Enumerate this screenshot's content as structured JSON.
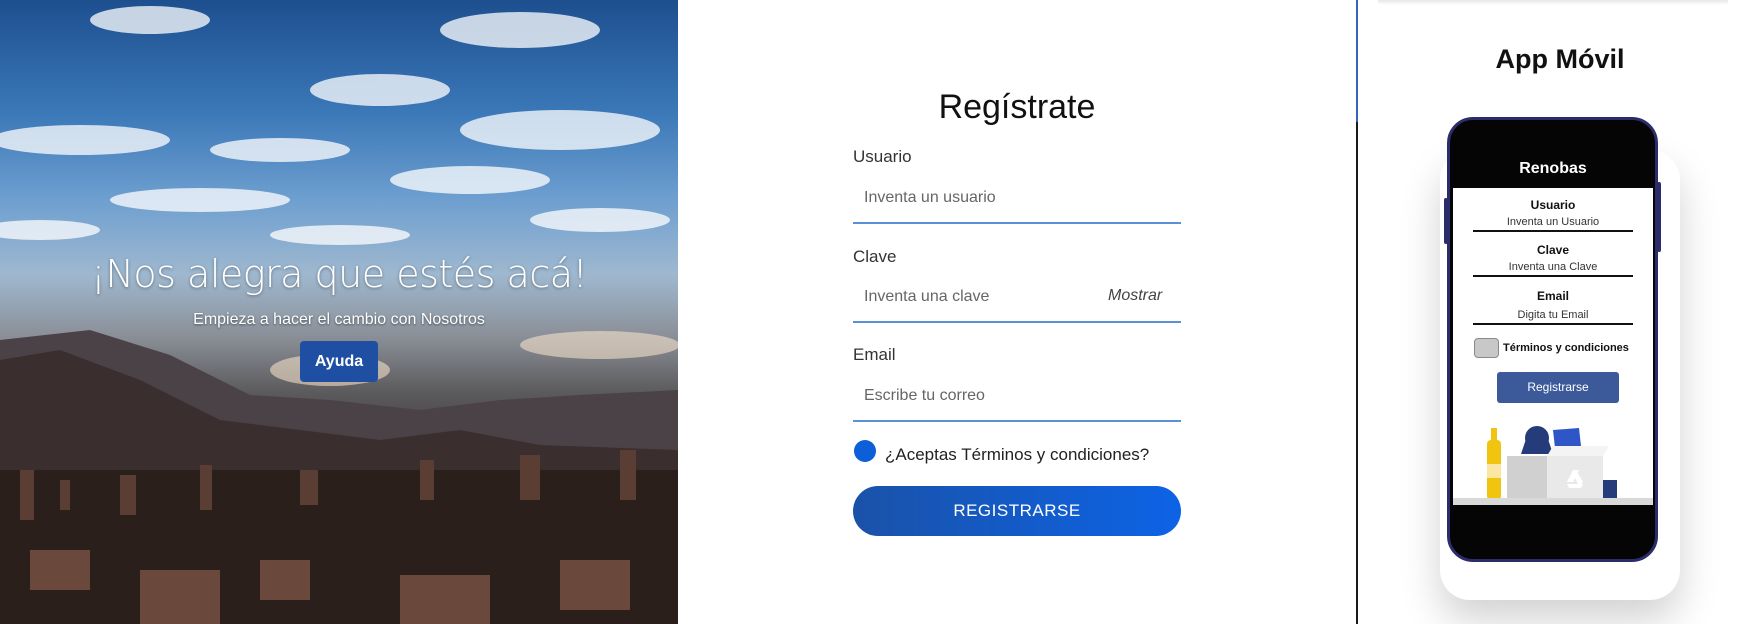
{
  "hero": {
    "title": "¡Nos alegra que estés acá!",
    "subtitle": "Empieza a hacer el cambio con Nosotros",
    "help_button": "Ayuda"
  },
  "form": {
    "title": "Regístrate",
    "user_label": "Usuario",
    "user_placeholder": "Inventa un usuario",
    "password_label": "Clave",
    "password_placeholder": "Inventa una clave",
    "show_password": "Mostrar",
    "email_label": "Email",
    "email_placeholder": "Escribe tu correo",
    "terms_label": "¿Aceptas Términos y condiciones?",
    "terms_checked": true,
    "submit_label": "REGISTRARSE"
  },
  "mobile": {
    "section_title": "App Móvil",
    "app_name": "Renobas",
    "user_label": "Usuario",
    "user_placeholder": "Inventa un Usuario",
    "password_label": "Clave",
    "password_placeholder": "Inventa una Clave",
    "email_label": "Email",
    "email_placeholder": "Digita tu Email",
    "terms_label": "Términos y condiciones",
    "submit_label": "Registrarse"
  },
  "colors": {
    "accent": "#0d63e6",
    "help_button": "#1f4fa3",
    "input_underline": "#5b8fd6",
    "phone_frame": "#2b2d6b",
    "mobile_button": "#3c5a9a"
  }
}
